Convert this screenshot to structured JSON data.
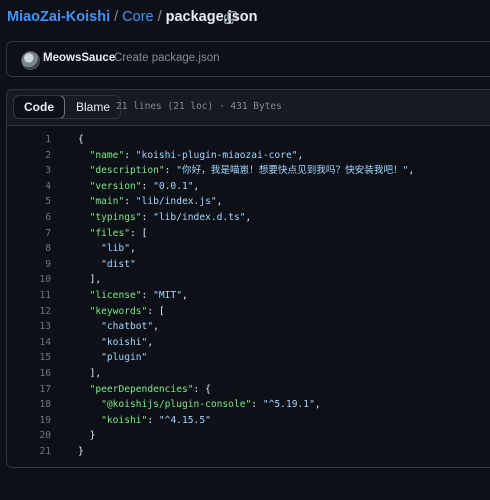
{
  "breadcrumb": {
    "owner": "MiaoZai-Koishi",
    "sep1": "/",
    "dir": "Core",
    "sep2": "/",
    "file": "package.json"
  },
  "commit": {
    "author": "MeowsSauce",
    "message": "Create package.json"
  },
  "file_header": {
    "tab_code": "Code",
    "tab_blame": "Blame",
    "meta": "21 lines (21 loc) · 431 Bytes"
  },
  "code_lines": [
    {
      "n": "1",
      "indent": "",
      "key": "",
      "value": "",
      "tail": "{"
    },
    {
      "n": "2",
      "indent": "  ",
      "key": "\"name\"",
      "value": "\"koishi-plugin-miaozai-core\"",
      "tail": ","
    },
    {
      "n": "3",
      "indent": "  ",
      "key": "\"description\"",
      "value": "\"你好，我是喵崽！想要快点见到我吗？快安装我吧！\"",
      "tail": ","
    },
    {
      "n": "4",
      "indent": "  ",
      "key": "\"version\"",
      "value": "\"0.0.1\"",
      "tail": ","
    },
    {
      "n": "5",
      "indent": "  ",
      "key": "\"main\"",
      "value": "\"lib/index.js\"",
      "tail": ","
    },
    {
      "n": "6",
      "indent": "  ",
      "key": "\"typings\"",
      "value": "\"lib/index.d.ts\"",
      "tail": ","
    },
    {
      "n": "7",
      "indent": "  ",
      "key": "\"files\"",
      "value": "",
      "tail": "["
    },
    {
      "n": "8",
      "indent": "    ",
      "key": "",
      "value": "\"lib\"",
      "tail": ","
    },
    {
      "n": "9",
      "indent": "    ",
      "key": "",
      "value": "\"dist\"",
      "tail": ""
    },
    {
      "n": "10",
      "indent": "  ",
      "key": "",
      "value": "",
      "tail": "],"
    },
    {
      "n": "11",
      "indent": "  ",
      "key": "\"license\"",
      "value": "\"MIT\"",
      "tail": ","
    },
    {
      "n": "12",
      "indent": "  ",
      "key": "\"keywords\"",
      "value": "",
      "tail": "["
    },
    {
      "n": "13",
      "indent": "    ",
      "key": "",
      "value": "\"chatbot\"",
      "tail": ","
    },
    {
      "n": "14",
      "indent": "    ",
      "key": "",
      "value": "\"koishi\"",
      "tail": ","
    },
    {
      "n": "15",
      "indent": "    ",
      "key": "",
      "value": "\"plugin\"",
      "tail": ""
    },
    {
      "n": "16",
      "indent": "  ",
      "key": "",
      "value": "",
      "tail": "],"
    },
    {
      "n": "17",
      "indent": "  ",
      "key": "\"peerDependencies\"",
      "value": "",
      "tail": "{"
    },
    {
      "n": "18",
      "indent": "    ",
      "key": "\"@koishijs/plugin-console\"",
      "value": "\"^5.19.1\"",
      "tail": ","
    },
    {
      "n": "19",
      "indent": "    ",
      "key": "\"koishi\"",
      "value": "\"^4.15.5\"",
      "tail": ""
    },
    {
      "n": "20",
      "indent": "  ",
      "key": "",
      "value": "",
      "tail": "}"
    },
    {
      "n": "21",
      "indent": "",
      "key": "",
      "value": "",
      "tail": "}"
    }
  ],
  "colors": {
    "background": "#0d1117",
    "link": "#4493f8",
    "json_key": "#7ee787",
    "json_string": "#a5d6ff",
    "line_number": "#6e7681",
    "border": "#30363d"
  },
  "icons": {
    "copy": "copy-icon",
    "avatar": "user-avatar"
  }
}
